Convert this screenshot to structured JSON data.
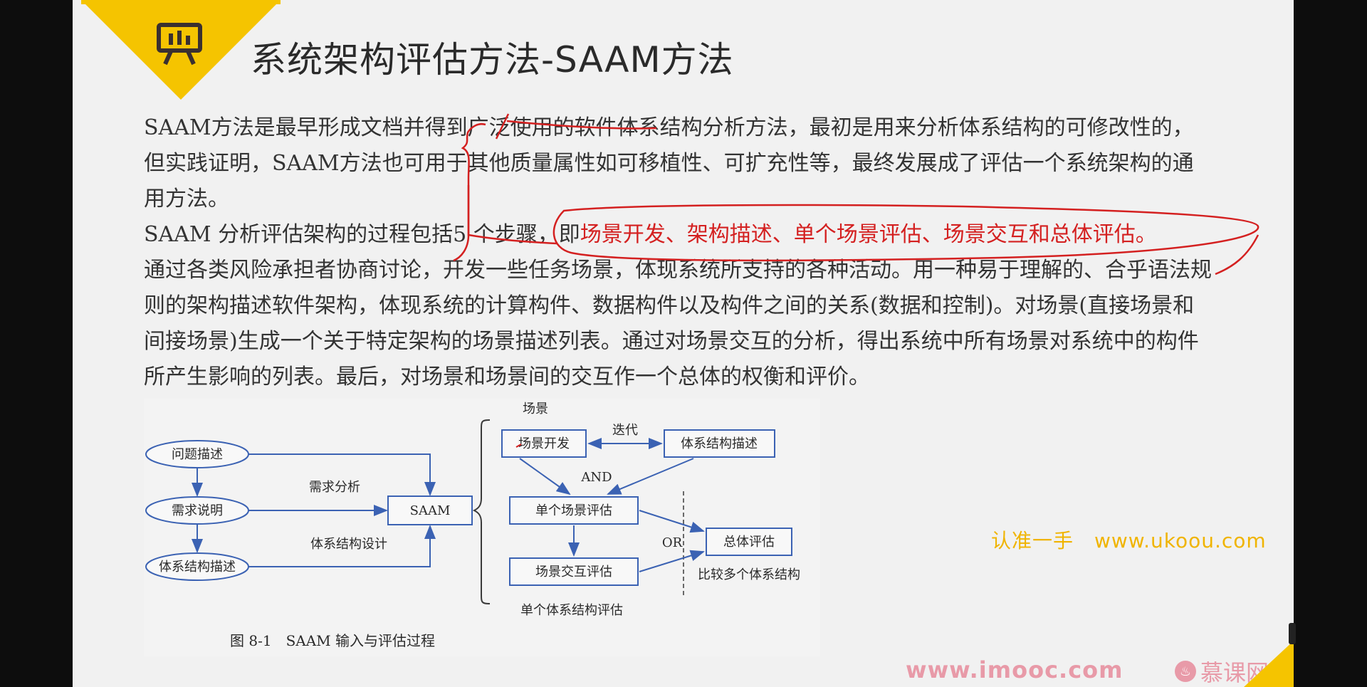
{
  "slide": {
    "title": "系统架构评估方法-SAAM方法",
    "paragraphs": [
      "SAAM方法是最早形成文档并得到广泛使用的软件体系结构分析方法，最初是用来分析体系结构的可修改性的，但实践证明，SAAM方法也可用于其他质量属性如可移植性、可扩充性等，最终发展成了评估一个系统架构的通用方法。",
      "SAAM 分析评估架构的过程包括5 个步骤，即",
      "场景开发、架构描述、单个场景评估、场景交互和总体评估。",
      "通过各类风险承担者协商讨论，开发一些任务场景，体现系统所支持的各种活动。用一种易于理解的、合乎语法规则的架构描述软件架构，体现系统的计算构件、数据构件以及构件之间的关系(数据和控制)。对场景(直接场景和间接场景)生成一个关于特定架构的场景描述列表。通过对场景交互的分析，得出系统中所有场景对系统中的构件所产生影响的列表。最后，对场景和场景间的交互作一个总体的权衡和评价。"
    ],
    "icon": "presentation-board-icon"
  },
  "figure": {
    "caption": "图 8-1　SAAM 输入与评估过程",
    "nodes": {
      "problem": "问题描述",
      "requirement": "需求说明",
      "arch_desc_left": "体系结构描述",
      "saam": "SAAM",
      "scene_dev": "场景开发",
      "arch_desc_right": "体系结构描述",
      "single_eval": "单个场景评估",
      "interact_eval": "场景交互评估",
      "overall_eval": "总体评估"
    },
    "labels": {
      "req_analysis": "需求分析",
      "arch_design": "体系结构设计",
      "scene": "场景",
      "iterate": "迭代",
      "and": "AND",
      "or": "OR",
      "single_arch_eval": "单个体系结构评估",
      "compare": "比较多个体系结构"
    }
  },
  "watermark": "认准一手　www.ukoou.com",
  "footer": {
    "url": "www.imooc.com",
    "brand": "慕课网"
  },
  "colors": {
    "accent": "#f5c400",
    "annotation": "#d42020",
    "watermark": "#f0b400",
    "footer": "#e89aa8"
  }
}
